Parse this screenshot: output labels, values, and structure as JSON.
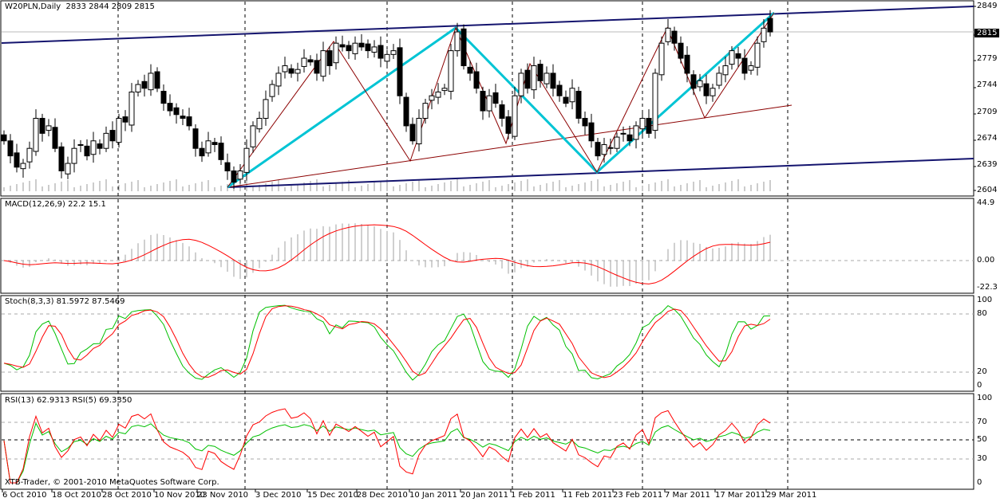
{
  "header": {
    "symbol_label": "W20PLN,Daily",
    "ohlc": "2833 2844 2809 2815"
  },
  "copyright": "XTB-Trader, © 2001-2010 MetaQuotes Software Corp.",
  "panels": {
    "macd": {
      "label": "MACD(12,26,9) 22.2 15.1",
      "axis": [
        "44.9",
        "0.00",
        "-22.3"
      ]
    },
    "stoch": {
      "label": "Stoch(8,3,3) 81.5972 87.5469",
      "axis": [
        "100",
        "80",
        "20",
        "0"
      ]
    },
    "rsi": {
      "label": "RSI(13) 62.9313  RSI(5) 69.3350",
      "axis": [
        "100",
        "70",
        "50",
        "30",
        "0"
      ]
    }
  },
  "price_axis": [
    "2849",
    "2779",
    "2744",
    "2709",
    "2674",
    "2639",
    "2604"
  ],
  "current_price": "2815",
  "colors": {
    "channel": "#14146e",
    "cyan": "#00c4d4",
    "zigzag": "#8b0000",
    "bull": "#ffffff",
    "bear": "#000000",
    "stoch_main": "#00c000",
    "stoch_signal": "#ff0000",
    "rsi13": "#00c000",
    "rsi5": "#ff0000",
    "macd_signal": "#ff0000",
    "macd_hist": "#a0a0a0"
  },
  "chart_data": {
    "type": "candlestick",
    "title": "W20PLN,Daily",
    "ylim": [
      2604,
      2849
    ],
    "x_tick_labels": [
      "6 Oct 2010",
      "18 Oct 2010",
      "28 Oct 2010",
      "10 Nov 2010",
      "23 Nov 2010",
      "3 Dec 2010",
      "15 Dec 2010",
      "28 Dec 2010",
      "10 Jan 2011",
      "20 Jan 2011",
      "1 Feb 2011",
      "11 Feb 2011",
      "23 Feb 2011",
      "7 Mar 2011",
      "17 Mar 2011",
      "29 Mar 2011"
    ],
    "closes": [
      2670,
      2650,
      2635,
      2640,
      2660,
      2700,
      2680,
      2690,
      2660,
      2630,
      2640,
      2660,
      2665,
      2650,
      2670,
      2660,
      2680,
      2670,
      2700,
      2695,
      2735,
      2745,
      2740,
      2760,
      2740,
      2720,
      2710,
      2705,
      2700,
      2690,
      2660,
      2650,
      2670,
      2665,
      2645,
      2630,
      2615,
      2630,
      2660,
      2690,
      2700,
      2725,
      2745,
      2760,
      2770,
      2760,
      2765,
      2780,
      2775,
      2760,
      2790,
      2770,
      2800,
      2795,
      2790,
      2800,
      2795,
      2790,
      2795,
      2780,
      2785,
      2790,
      2730,
      2690,
      2670,
      2700,
      2720,
      2730,
      2735,
      2740,
      2790,
      2815,
      2770,
      2760,
      2740,
      2710,
      2730,
      2720,
      2700,
      2680,
      2730,
      2760,
      2740,
      2770,
      2750,
      2760,
      2740,
      2730,
      2720,
      2740,
      2700,
      2690,
      2670,
      2650,
      2665,
      2660,
      2675,
      2680,
      2670,
      2690,
      2700,
      2680,
      2760,
      2800,
      2820,
      2800,
      2780,
      2760,
      2740,
      2750,
      2730,
      2740,
      2760,
      2770,
      2790,
      2780,
      2760,
      2770,
      2800,
      2820,
      2815
    ],
    "last_ohlc": [
      2833,
      2844,
      2809,
      2815
    ],
    "indicators": [
      "MACD(12,26,9)",
      "Stoch(8,3,3)",
      "RSI(13)",
      "RSI(5)"
    ]
  }
}
